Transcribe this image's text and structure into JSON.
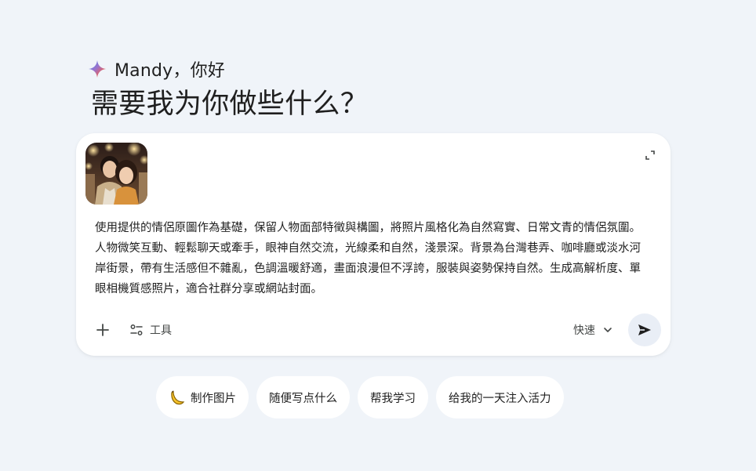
{
  "greeting": {
    "name_line": "Mandy，你好",
    "headline": "需要我为你做些什么？"
  },
  "composer": {
    "prompt": "使用提供的情侶原圖作為基礎，保留人物面部特徵與構圖，將照片風格化為自然寫實、日常文青的情侶氛圍。人物微笑互動、輕鬆聊天或牽手，眼神自然交流，光線柔和自然，淺景深。背景為台灣巷弄、咖啡廳或淡水河岸街景，帶有生活感但不雜亂，色調溫暖舒適，畫面浪漫但不浮誇，服裝與姿勢保持自然。生成高解析度、單眼相機質感照片，適合社群分享或網站封面。",
    "tools_label": "工具",
    "model_label": "快速",
    "icons": {
      "add": "plus-icon",
      "tools": "tools-icon",
      "send": "send-icon",
      "expand": "expand-icon",
      "dropdown": "chevron-down-icon"
    }
  },
  "chips": [
    {
      "label": "制作图片",
      "icon": "banana-icon"
    },
    {
      "label": "随便写点什么"
    },
    {
      "label": "帮我学习"
    },
    {
      "label": "给我的一天注入活力"
    }
  ],
  "colors": {
    "background": "#f0f4f9",
    "card": "#ffffff",
    "send_bg": "#e9eef6",
    "text": "#1f1f1f",
    "muted": "#444746"
  }
}
